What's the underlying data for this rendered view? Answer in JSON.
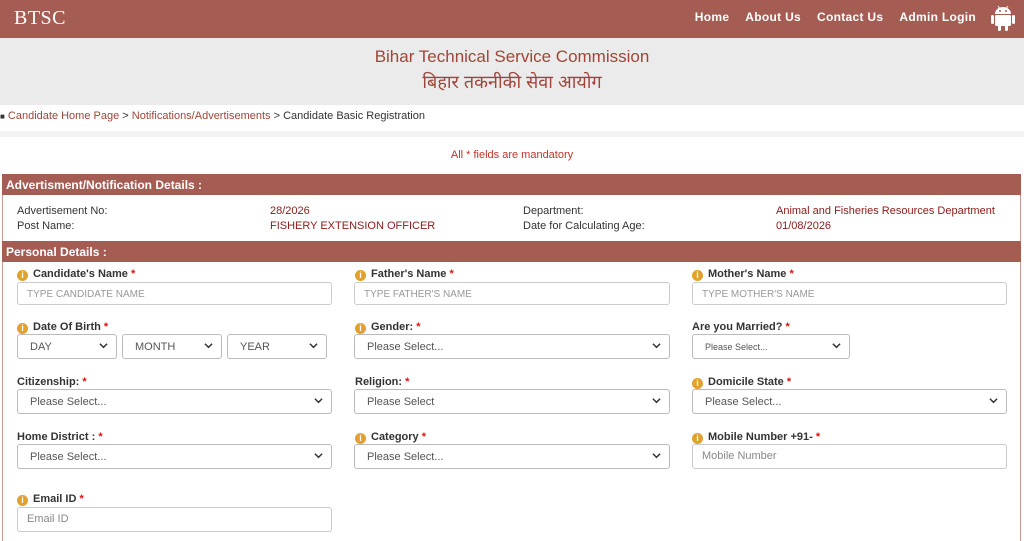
{
  "navbar": {
    "brand": "BTSC",
    "links": [
      "Home",
      "About Us",
      "Contact Us",
      "Admin Login"
    ]
  },
  "header": {
    "title_en": "Bihar Technical Service Commission",
    "title_hi": "बिहार तकनीकी सेवा आयोग"
  },
  "breadcrumb": {
    "home": "Candidate Home Page",
    "notifications": "Notifications/Advertisements",
    "current": "Candidate Basic Registration",
    "separator": ">"
  },
  "mandatory_note": "All * fields are mandatory",
  "advert_section": {
    "title": "Advertisment/Notification Details :",
    "adv_no_label": "Advertisement No:",
    "adv_no_value": "28/2026",
    "post_label": "Post Name:",
    "post_value": "FISHERY EXTENSION OFFICER",
    "dept_label": "Department:",
    "dept_value": "Animal and Fisheries Resources Department",
    "age_date_label": "Date for Calculating Age:",
    "age_date_value": "01/08/2026"
  },
  "personal_section": {
    "title": "Personal Details :",
    "candidate_name": {
      "label": "Candidate's Name",
      "placeholder": "TYPE CANDIDATE NAME"
    },
    "father_name": {
      "label": "Father's Name",
      "placeholder": "TYPE FATHER'S NAME"
    },
    "mother_name": {
      "label": "Mother's Name",
      "placeholder": "TYPE MOTHER'S NAME"
    },
    "dob": {
      "label": "Date Of Birth",
      "day": "DAY",
      "month": "MONTH",
      "year": "YEAR"
    },
    "gender": {
      "label": "Gender:",
      "value": "Please Select..."
    },
    "married": {
      "label": "Are you Married?",
      "value": "Please Select..."
    },
    "citizenship": {
      "label": "Citizenship:",
      "value": "Please Select..."
    },
    "religion": {
      "label": "Religion:",
      "value": "Please Select"
    },
    "domicile": {
      "label": "Domicile State",
      "value": "Please Select..."
    },
    "home_district": {
      "label": "Home District :",
      "value": "Please Select..."
    },
    "category": {
      "label": "Category",
      "value": "Please Select..."
    },
    "mobile": {
      "label": "Mobile Number +91-",
      "placeholder": "Mobile Number"
    },
    "email": {
      "label": "Email ID",
      "placeholder": "Email ID"
    }
  },
  "required_mark": "*",
  "colors": {
    "brand": "#a55d53",
    "accent_text": "#a0453a",
    "required": "#dd1111",
    "info_icon": "#e0a22a"
  },
  "icons": {
    "info": "info-circle-icon",
    "android": "android-icon",
    "dropdown": "chevron-down-icon"
  }
}
